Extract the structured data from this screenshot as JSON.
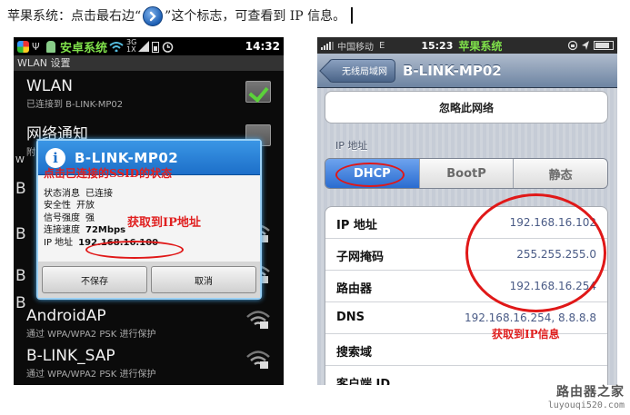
{
  "caption": {
    "before_icon": "苹果系统：点击最右边“",
    "after_icon": "”这个标志，可查看到 IP 信息。"
  },
  "android": {
    "status_time": "14:32",
    "status_watermark": "安卓系统",
    "screen_title": "WLAN 设置",
    "rows": [
      {
        "title": "WLAN",
        "subtitle": "已连接到 B-LINK-MP02"
      },
      {
        "title": "网络通知",
        "subtitle": "附"
      },
      {
        "title": "AndroidAP",
        "subtitle": "通过 WPA/WPA2 PSK 进行保护"
      },
      {
        "title": "B-LINK_SAP",
        "subtitle": "通过 WPA/WPA2 PSK 进行保护"
      }
    ],
    "side_letters": [
      "W",
      "B",
      "B",
      "B",
      "B"
    ],
    "dialog": {
      "title": "B-LINK-MP02",
      "annotation_top": "点击已连接的SSID的状态",
      "annotation_mid": "获取到IP地址",
      "fields": [
        {
          "label": "状态消息",
          "value": "已连接"
        },
        {
          "label": "安全性",
          "value": "开放"
        },
        {
          "label": "信号强度",
          "value": "强"
        },
        {
          "label": "连接速度",
          "value": "72Mbps"
        },
        {
          "label": "IP 地址",
          "value": "192.168.16.100"
        }
      ],
      "button_left": "不保存",
      "button_right": "取消"
    }
  },
  "iphone": {
    "carrier": "中国移动",
    "network": "E",
    "time": "15:23",
    "watermark": "苹果系统",
    "back_label": "无线局域网",
    "nav_title": "B-LINK-MP02",
    "forget_label": "忽略此网络",
    "section_label": "IP 地址",
    "segments": [
      "DHCP",
      "BootP",
      "静态"
    ],
    "rows": [
      {
        "label": "IP 地址",
        "value": "192.168.16.102"
      },
      {
        "label": "子网掩码",
        "value": "255.255.255.0"
      },
      {
        "label": "路由器",
        "value": "192.168.16.254"
      },
      {
        "label": "DNS",
        "value": "192.168.16.254, 8.8.8.8"
      },
      {
        "label": "搜索域",
        "value": ""
      },
      {
        "label": "客户端 ID",
        "value": ""
      }
    ],
    "annotation": "获取到IP信息"
  },
  "footer": {
    "site_name": "路由器之家",
    "site_url": "luyouqi520.com"
  },
  "colors": {
    "annotation_red": "#e02020",
    "android_accent": "#1d6fc9",
    "ios_segment_selected": "#2a6cd0"
  }
}
